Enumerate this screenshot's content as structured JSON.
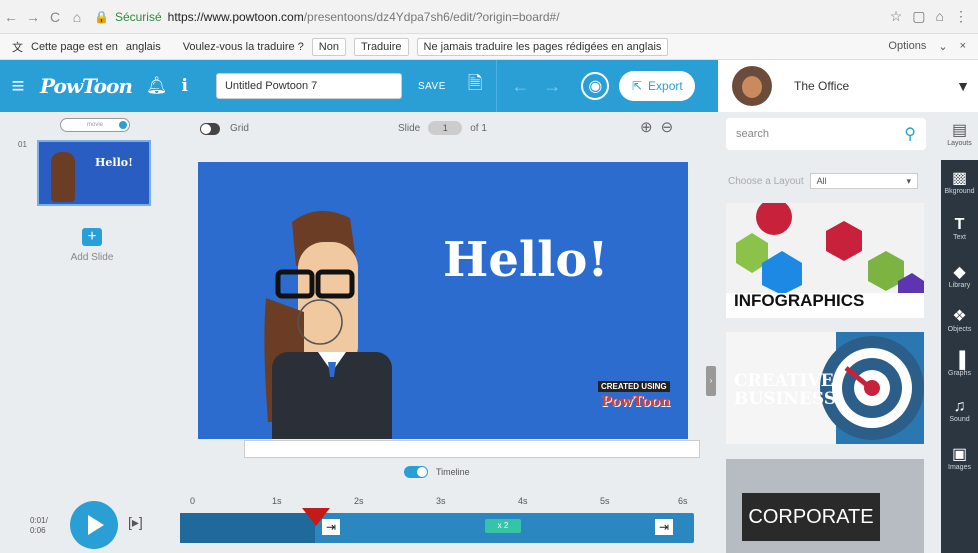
{
  "browser": {
    "secure_label": "Sécurisé",
    "url_host": "https://www.powtoon.com",
    "url_path": "/presentoons/dz4Ydpa7sh6/edit/?origin=board#/"
  },
  "translate_bar": {
    "prefix": "Cette page est en",
    "language": "anglais",
    "question": "Voulez-vous la traduire ?",
    "no_button": "Non",
    "translate_button": "Traduire",
    "never_button": "Ne jamais traduire les pages rédigées en anglais",
    "options_label": "Options"
  },
  "toolbar": {
    "logo": "PowToon",
    "title_value": "Untitled Powtoon 7",
    "save_label": "SAVE",
    "export_label": "Export"
  },
  "account": {
    "workspace_name": "The Office"
  },
  "slides_panel": {
    "mode_label": "movie",
    "slide_number": "01",
    "thumb_text": "Hello!",
    "add_slide_label": "Add Slide"
  },
  "canvas": {
    "grid_label": "Grid",
    "slide_label": "Slide",
    "slide_current": "1",
    "slide_of": "of 1",
    "headline": "Hello!",
    "watermark_top": "CREATED USING",
    "watermark_bottom": "PowToon",
    "timeline_label": "Timeline"
  },
  "player": {
    "time_current": "0:01",
    "time_total": "0:06",
    "ticks": [
      "0",
      "1s",
      "2s",
      "3s",
      "4s",
      "5s",
      "6s"
    ],
    "clip_label": "x 2"
  },
  "right_panel": {
    "search_placeholder": "search",
    "choose_layout_label": "Choose a Layout",
    "layout_filter": "All",
    "cards": [
      {
        "title": "INFOGRAPHICS"
      },
      {
        "title": "CREATIVE BUSINESS"
      },
      {
        "title": "CORPORATE"
      }
    ]
  },
  "icon_rail": {
    "items": [
      {
        "label": "Layouts",
        "icon": "layouts-icon"
      },
      {
        "label": "Bkground",
        "icon": "background-icon"
      },
      {
        "label": "Text",
        "icon": "text-icon"
      },
      {
        "label": "Library",
        "icon": "library-icon"
      },
      {
        "label": "Objects",
        "icon": "objects-icon"
      },
      {
        "label": "Graphs",
        "icon": "graphs-icon"
      },
      {
        "label": "Sound",
        "icon": "sound-icon"
      },
      {
        "label": "Images",
        "icon": "images-icon"
      }
    ]
  },
  "colors": {
    "brand_blue": "#2a9fd6",
    "stage_blue": "#2d6ccf",
    "playhead_red": "#c41a1a",
    "rail_dark": "#2c3641"
  }
}
